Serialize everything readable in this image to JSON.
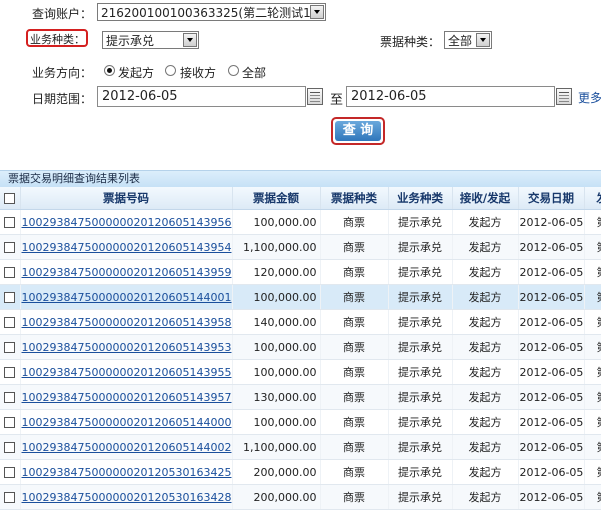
{
  "form": {
    "account_label": "查询账户：",
    "account_value": "216200100100363325(第二轮测试1)",
    "biz_type_label": "业务种类：",
    "biz_type_value": "提示承兑",
    "bill_type_label": "票据种类：",
    "bill_type_value": "全部",
    "direction_label": "业务方向：",
    "direction_options": [
      "发起方",
      "接收方",
      "全部"
    ],
    "direction_selected": "发起方",
    "date_label": "日期范围：",
    "date_from": "2012-06-05",
    "date_to_sep": "至",
    "date_to": "2012-06-05",
    "more_link": "更多",
    "query_button": "查 询"
  },
  "results": {
    "title": "票据交易明细查询结果列表",
    "columns": [
      "票据号码",
      "票据金额",
      "票据种类",
      "业务种类",
      "接收/发起",
      "交易日期",
      "发"
    ],
    "rows": [
      {
        "no": "1002938475000000201206051439​56",
        "amount": "100,000.00",
        "bill": "商票",
        "biz": "提示承兑",
        "dir": "发起方",
        "date": "2012-06-05",
        "extra": "第"
      },
      {
        "no": "100293847500000020120605143954",
        "amount": "1,100,000.00",
        "bill": "商票",
        "biz": "提示承兑",
        "dir": "发起方",
        "date": "2012-06-05",
        "extra": "第"
      },
      {
        "no": "100293847500000020120605143959",
        "amount": "120,000.00",
        "bill": "商票",
        "biz": "提示承兑",
        "dir": "发起方",
        "date": "2012-06-05",
        "extra": "第"
      },
      {
        "no": "100293847500000020120605144001",
        "amount": "100,000.00",
        "bill": "商票",
        "biz": "提示承兑",
        "dir": "发起方",
        "date": "2012-06-05",
        "extra": "第"
      },
      {
        "no": "100293847500000020120605143958",
        "amount": "140,000.00",
        "bill": "商票",
        "biz": "提示承兑",
        "dir": "发起方",
        "date": "2012-06-05",
        "extra": "第"
      },
      {
        "no": "100293847500000020120605143953",
        "amount": "100,000.00",
        "bill": "商票",
        "biz": "提示承兑",
        "dir": "发起方",
        "date": "2012-06-05",
        "extra": "第"
      },
      {
        "no": "100293847500000020120605143955",
        "amount": "100,000.00",
        "bill": "商票",
        "biz": "提示承兑",
        "dir": "发起方",
        "date": "2012-06-05",
        "extra": "第"
      },
      {
        "no": "100293847500000020120605143957",
        "amount": "130,000.00",
        "bill": "商票",
        "biz": "提示承兑",
        "dir": "发起方",
        "date": "2012-06-05",
        "extra": "第"
      },
      {
        "no": "100293847500000020120605144000",
        "amount": "100,000.00",
        "bill": "商票",
        "biz": "提示承兑",
        "dir": "发起方",
        "date": "2012-06-05",
        "extra": "第"
      },
      {
        "no": "100293847500000020120605144002",
        "amount": "1,100,000.00",
        "bill": "商票",
        "biz": "提示承兑",
        "dir": "发起方",
        "date": "2012-06-05",
        "extra": "第"
      },
      {
        "no": "100293847500000020120530163425",
        "amount": "200,000.00",
        "bill": "商票",
        "biz": "提示承兑",
        "dir": "发起方",
        "date": "2012-06-05",
        "extra": "第"
      },
      {
        "no": "100293847500000020120530163428",
        "amount": "200,000.00",
        "bill": "商票",
        "biz": "提示承兑",
        "dir": "发起方",
        "date": "2012-06-05",
        "extra": "第"
      }
    ]
  }
}
